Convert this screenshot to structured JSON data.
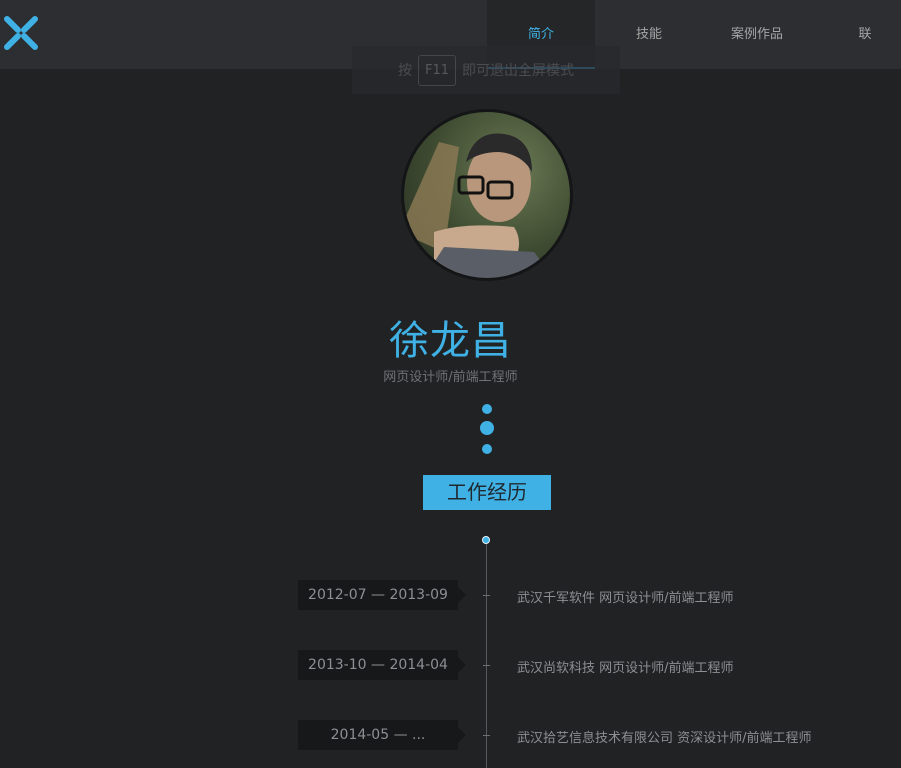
{
  "header": {
    "nav": [
      {
        "label": "简介"
      },
      {
        "label": "技能"
      },
      {
        "label": "案例作品"
      },
      {
        "label": "联"
      }
    ]
  },
  "fullscreen_hint": {
    "prefix": "按",
    "key": "F11",
    "suffix": "即可退出全屏模式"
  },
  "profile": {
    "name": "徐龙昌",
    "title": "网页设计师/前端工程师"
  },
  "section": {
    "title": "工作经历"
  },
  "timeline": [
    {
      "date": "2012-07 — 2013-09",
      "company": "武汉千军软件",
      "role": "网页设计师/前端工程师"
    },
    {
      "date": "2013-10 — 2014-04",
      "company": "武汉尚软科技",
      "role": "网页设计师/前端工程师"
    },
    {
      "date": "2014-05 — ...",
      "company": "武汉拾艺信息技术有限公司",
      "role": "资深设计师/前端工程师"
    }
  ],
  "colors": {
    "accent": "#3fb1e5",
    "background": "#212224",
    "header": "#2c2e31"
  }
}
